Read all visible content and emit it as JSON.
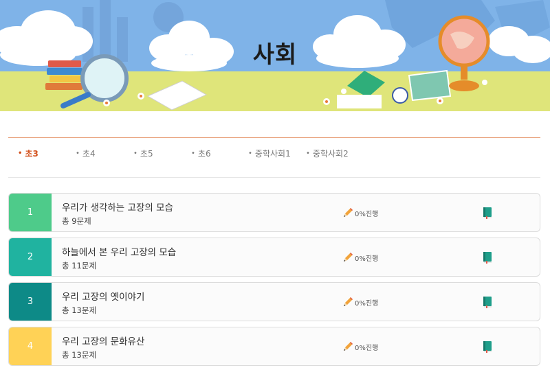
{
  "header": {
    "title": "사회"
  },
  "tabs": [
    {
      "label": "초3",
      "active": true
    },
    {
      "label": "초4",
      "active": false
    },
    {
      "label": "초5",
      "active": false
    },
    {
      "label": "초6",
      "active": false
    },
    {
      "label": "중학사회1",
      "active": false
    },
    {
      "label": "중학사회2",
      "active": false
    }
  ],
  "units": [
    {
      "number": "1",
      "title": "우리가 생각하는 고장의 모습",
      "count": "총 9문제",
      "progress": "0%진행",
      "color": "#4ecb8a"
    },
    {
      "number": "2",
      "title": "하늘에서 본 우리 고장의 모습",
      "count": "총 11문제",
      "progress": "0%진행",
      "color": "#20b3a0"
    },
    {
      "number": "3",
      "title": "우리 고장의 옛이야기",
      "count": "총 13문제",
      "progress": "0%진행",
      "color": "#0d8a87"
    },
    {
      "number": "4",
      "title": "우리 고장의 문화유산",
      "count": "총 13문제",
      "progress": "0%진행",
      "color": "#ffd256"
    }
  ],
  "icons": {
    "progress": "pencil-icon",
    "study": "book-icon"
  },
  "colors": {
    "active_tab": "#d3521e",
    "tab_line": "#e8a07a",
    "banner_sky": "#7fb3e8",
    "banner_ground": "#dfe57a"
  }
}
